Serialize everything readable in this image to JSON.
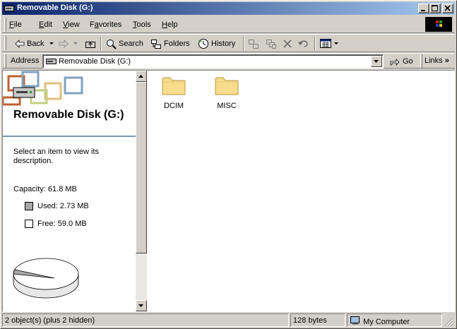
{
  "window": {
    "title": "Removable Disk (G:)",
    "icon": "drive-icon",
    "controls": [
      "minimize",
      "maximize",
      "close"
    ]
  },
  "menu": [
    {
      "label": "File",
      "key": "F",
      "rest": "ile"
    },
    {
      "label": "Edit",
      "key": "E",
      "rest": "dit"
    },
    {
      "label": "View",
      "key": "V",
      "rest": "iew"
    },
    {
      "label": "Favorites",
      "key": "a",
      "pre": "F",
      "rest": "vorites"
    },
    {
      "label": "Tools",
      "key": "T",
      "rest": "ools"
    },
    {
      "label": "Help",
      "key": "H",
      "rest": "elp"
    }
  ],
  "toolbar": {
    "back": "Back",
    "search": "Search",
    "folders": "Folders",
    "history": "History"
  },
  "address": {
    "label": "Address",
    "value": "Removable Disk (G:)",
    "go": "Go",
    "links": "Links"
  },
  "left_pane": {
    "title": "Removable Disk (G:)",
    "description": "Select an item to view its description.",
    "capacity": "Capacity: 61.8 MB",
    "used": "Used: 2.73 MB",
    "free": "Free: 59.0 MB",
    "used_color": "#a8a8a8",
    "free_color": "#ffffff",
    "used_fraction": 0.044
  },
  "items": [
    {
      "name": "DCIM",
      "type": "folder"
    },
    {
      "name": "MISC",
      "type": "folder"
    }
  ],
  "status": {
    "objects": "2 object(s) (plus 2 hidden)",
    "size": "128 bytes",
    "zone": "My Computer"
  }
}
